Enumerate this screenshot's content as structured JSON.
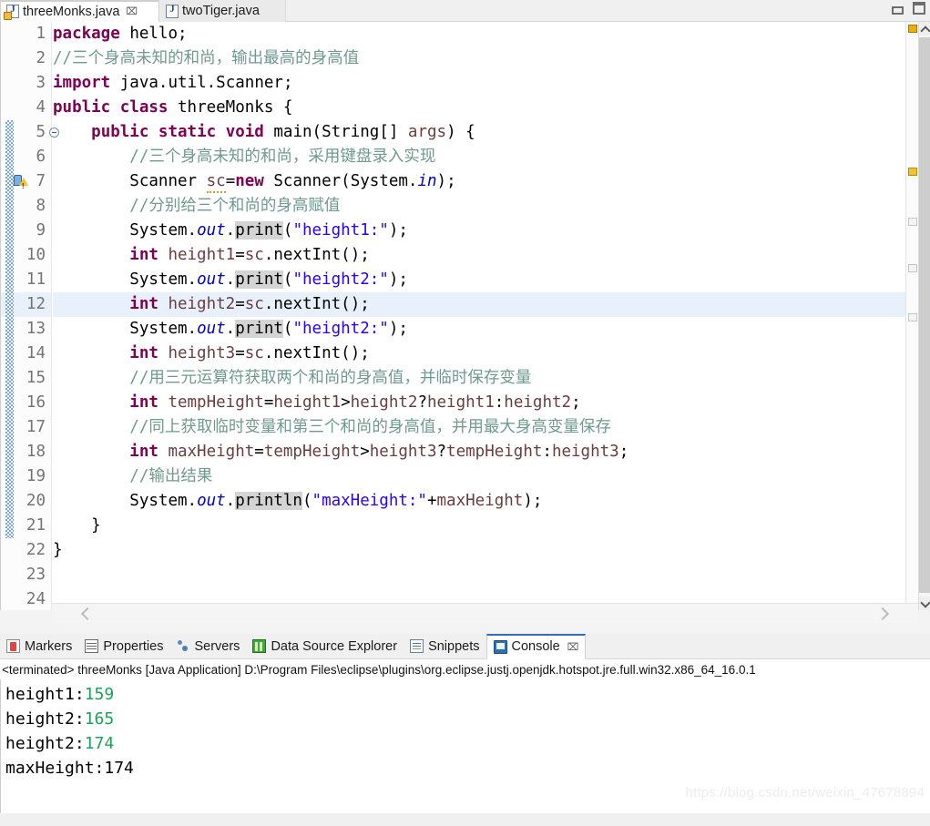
{
  "window": {
    "minimize_label": "minimize",
    "maximize_label": "maximize"
  },
  "editor_tabs": [
    {
      "label": "threeMonks.java",
      "icon": "java-file-warning-icon",
      "active": true,
      "close": "⌧"
    },
    {
      "label": "twoTiger.java",
      "icon": "java-file-icon",
      "active": false
    }
  ],
  "code": {
    "lines": [
      {
        "num": "1",
        "text": "package hello;"
      },
      {
        "num": "2",
        "text": "//三个身高未知的和尚，输出最高的身高值"
      },
      {
        "num": "3",
        "text": "import java.util.Scanner;"
      },
      {
        "num": "4",
        "text": "public class threeMonks {"
      },
      {
        "num": "5",
        "text": "    public static void main(String[] args) {"
      },
      {
        "num": "6",
        "text": "        //三个身高未知的和尚，采用键盘录入实现"
      },
      {
        "num": "7",
        "text": "        Scanner sc=new Scanner(System.in);"
      },
      {
        "num": "8",
        "text": "        //分别给三个和尚的身高赋值"
      },
      {
        "num": "9",
        "text": "        System.out.print(\"height1:\");"
      },
      {
        "num": "10",
        "text": "        int height1=sc.nextInt();"
      },
      {
        "num": "11",
        "text": "        System.out.print(\"height2:\");"
      },
      {
        "num": "12",
        "text": "        int height2=sc.nextInt();"
      },
      {
        "num": "13",
        "text": "        System.out.print(\"height2:\");"
      },
      {
        "num": "14",
        "text": "        int height3=sc.nextInt();"
      },
      {
        "num": "15",
        "text": "        //用三元运算符获取两个和尚的身高值，并临时保存变量"
      },
      {
        "num": "16",
        "text": "        int tempHeight=height1>height2?height1:height2;"
      },
      {
        "num": "17",
        "text": "        //同上获取临时变量和第三个和尚的身高值，并用最大身高变量保存"
      },
      {
        "num": "18",
        "text": "        int maxHeight=tempHeight>height3?tempHeight:height3;"
      },
      {
        "num": "19",
        "text": "        //输出结果"
      },
      {
        "num": "20",
        "text": "        System.out.println(\"maxHeight:\"+maxHeight);"
      },
      {
        "num": "21",
        "text": "    }"
      },
      {
        "num": "22",
        "text": "}"
      },
      {
        "num": "23",
        "text": ""
      },
      {
        "num": "24",
        "text": ""
      }
    ],
    "current_line": "12",
    "warning_line": "7",
    "fold_line": "5"
  },
  "panel_tabs": [
    {
      "label": "Markers",
      "icon": "markers-icon",
      "active": false
    },
    {
      "label": "Properties",
      "icon": "properties-icon",
      "active": false
    },
    {
      "label": "Servers",
      "icon": "servers-icon",
      "active": false
    },
    {
      "label": "Data Source Explorer",
      "icon": "data-source-explorer-icon",
      "active": false
    },
    {
      "label": "Snippets",
      "icon": "snippets-icon",
      "active": false
    },
    {
      "label": "Console",
      "icon": "console-icon",
      "active": true,
      "close": "⌧"
    }
  ],
  "console": {
    "header": "<terminated> threeMonks [Java Application] D:\\Program Files\\eclipse\\plugins\\org.eclipse.justj.openjdk.hotspot.jre.full.win32.x86_64_16.0.1",
    "output": [
      {
        "label": "height1:",
        "value": "159",
        "is_input": true
      },
      {
        "label": "height2:",
        "value": "165",
        "is_input": true
      },
      {
        "label": "height2:",
        "value": "174",
        "is_input": true
      },
      {
        "label": "maxHeight:174",
        "value": "",
        "is_input": false
      }
    ]
  },
  "watermark": "https://blog.csdn.net/weixin_47678894",
  "colors": {
    "keyword": "#7f0055",
    "string": "#2a00ff",
    "comment": "#6f9a8d",
    "field": "#0000c0",
    "local": "#6a3e3e",
    "console_input": "#1aa35c",
    "current_line": "#e8f0fb",
    "occurrence": "#d4d4d4"
  }
}
